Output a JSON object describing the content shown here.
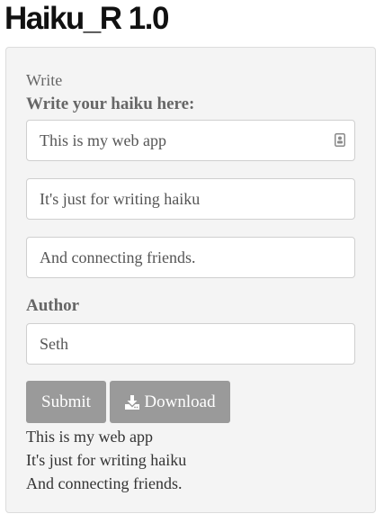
{
  "app": {
    "title": "Haiku_R 1.0"
  },
  "panel": {
    "section_label": "Write",
    "haiku_label": "Write your haiku here:",
    "line1_value": "This is my web app",
    "line2_value": "It's just for writing haiku",
    "line3_value": "And connecting friends.",
    "author_label": "Author",
    "author_value": "Seth",
    "submit_label": "Submit",
    "download_label": "Download",
    "download_icon": "download-icon",
    "contact_card_icon": "contact-card-icon"
  },
  "output": {
    "lines": [
      "This is my web app",
      "It's just for writing haiku",
      "And connecting friends."
    ]
  },
  "colors": {
    "panel_background": "#f4f4f4",
    "button_background": "#9a9a9a",
    "label_text": "#666666",
    "body_text": "#333333"
  }
}
